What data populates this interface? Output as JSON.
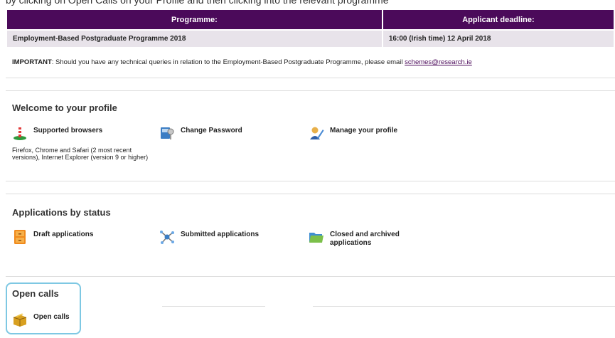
{
  "header_fragment": "by clicking on Open Calls on your Profile and then clicking into the relevant programme",
  "table": {
    "headers": [
      "Programme:",
      "Applicant deadline:"
    ],
    "rows": [
      [
        "Employment-Based Postgraduate Programme 2018",
        "16:00 (Irish time) 12 April 2018"
      ]
    ]
  },
  "important": {
    "label": "IMPORTANT",
    "text": ": Should you have any technical queries in relation to the Employment-Based Postgraduate Programme, please email ",
    "email": "schemes@research.ie"
  },
  "profile": {
    "title": "Welcome to your profile",
    "browsers_label": "Supported browsers",
    "browsers_note": "Firefox, Chrome and Safari (2 most recent versions), Internet Explorer (version 9 or higher)",
    "change_password": "Change Password",
    "manage_profile": "Manage your profile"
  },
  "status": {
    "title": "Applications by status",
    "draft": "Draft applications",
    "submitted": "Submitted applications",
    "closed": "Closed and archived applications"
  },
  "open_calls": {
    "title": "Open calls",
    "link": "Open calls"
  }
}
